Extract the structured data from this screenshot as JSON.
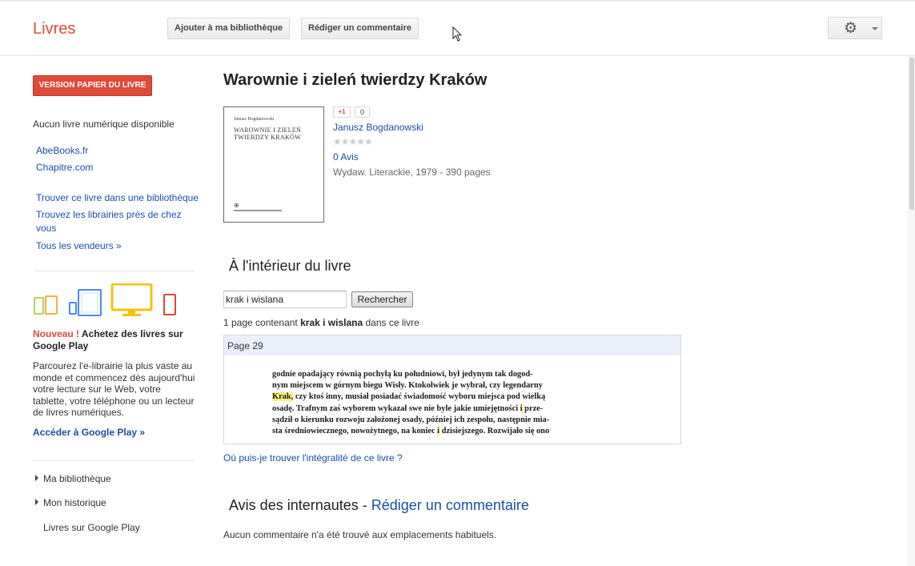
{
  "header": {
    "brand": "Livres",
    "add_to_library_label": "Ajouter à ma bibliothèque",
    "write_review_label": "Rédiger un commentaire",
    "settings_icon": "gear-icon"
  },
  "sidebar": {
    "print_version_label": "VERSION PAPIER DU LIVRE",
    "no_ebook": "Aucun livre numérique disponible",
    "sellers": [
      "AbeBooks.fr",
      "Chapitre.com"
    ],
    "find_library": "Trouver ce livre dans une bibliothèque",
    "find_stores": "Trouvez les librairies près de chez",
    "find_stores_2": "vous",
    "all_sellers": "Tous les vendeurs »",
    "promo": {
      "new_label": "Nouveau !",
      "title": "Achetez des livres sur Google Play",
      "body": "Parcourez l'e-librairie la plus vaste au monde et commencez dès aujourd'hui votre lecture sur le Web, votre tablette, votre téléphone ou un lecteur de livres numériques.",
      "link": "Accéder à Google Play »"
    },
    "menu": {
      "my_library": "Ma bibliothèque",
      "my_history": "Mon historique",
      "play_books": "Livres sur Google Play"
    }
  },
  "book": {
    "title": "Warownie i zieleń twierdzy Kraków",
    "cover_author": "Janusz Bogdanowski",
    "cover_title_1": "WAROWNIE I ZIELEŃ",
    "cover_title_2": "TWIERDZY KRAKÓW",
    "gplus_label": "+1",
    "gplus_count": "0",
    "author": "Janusz Bogdanowski",
    "stars": "★★★★★",
    "rating_fraction": 0,
    "reviews_count": "0 Avis",
    "publication": "Wydaw. Literackie, 1979 - 390 pages"
  },
  "inside": {
    "heading": "À l'intérieur du livre",
    "search_value": "krak i wislana",
    "search_button": "Rechercher",
    "result_prefix": "1 page contenant ",
    "result_query": "krak i wislana",
    "result_suffix": " dans ce livre",
    "page_label": "Page 29",
    "snippet_lines": [
      {
        "a": "godnie opadający równią pochyłą ku południowi, był jedynym tak dogod-"
      },
      {
        "a": "nym miejscem w górnym biegu Wisły. Ktokolwiek je wybrał, czy legendarny"
      },
      {
        "hl": "Krak,",
        "a": " czy ktoś inny, musiał posiadać świadomość wyboru miejsca pod wielką"
      },
      {
        "a": "osadę. Trafnym zaś wyborem wykazał swe nie byle jakie umiejętności ",
        "hl2": "i",
        "b": " prze-"
      },
      {
        "a": "sądził o kierunku rozwoju założonej osady, później ich zespołu, następnie mia-"
      },
      {
        "a": "sta średniowiecznego, nowożytnego, na koniec ",
        "hl2": "i",
        "b": " dzisiejszego. Rozwijało się ono"
      }
    ],
    "fulltext_link": "Où puis-je trouver l'intégralité de ce livre ?"
  },
  "user_reviews": {
    "heading": "Avis des internautes - ",
    "heading_link": "Rédiger un commentaire",
    "empty": "Aucun commentaire n'a été trouvé aux emplacements habituels."
  }
}
